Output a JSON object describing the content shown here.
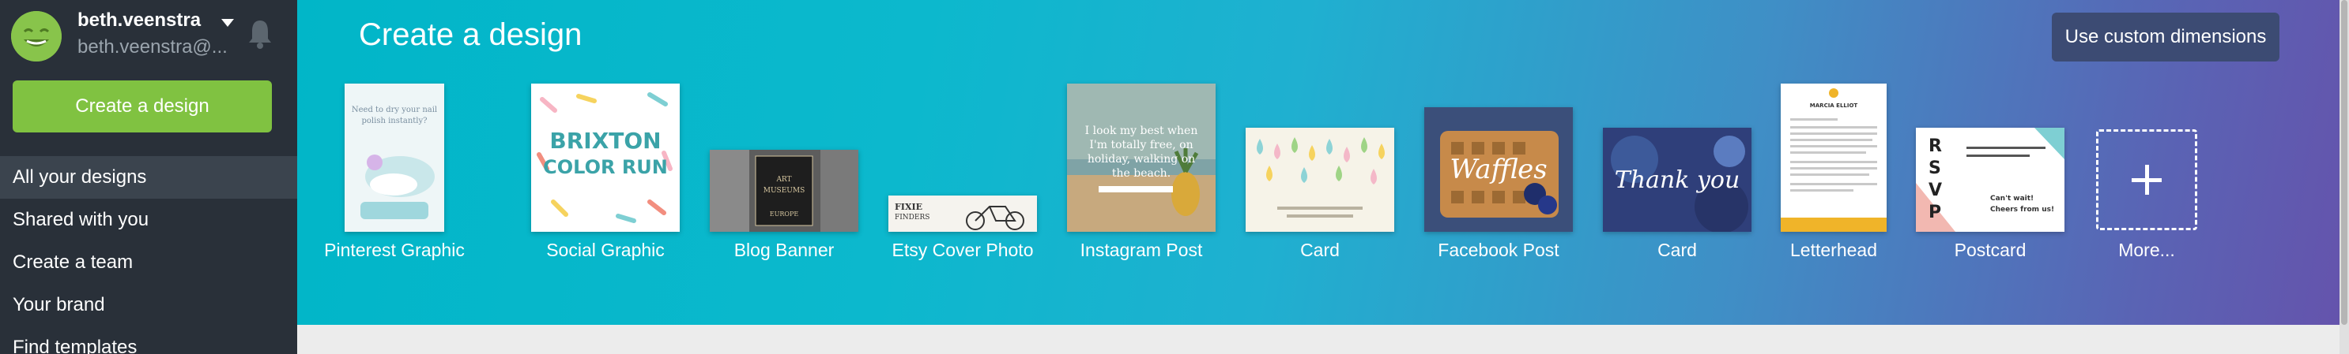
{
  "user": {
    "username": "beth.veenstra",
    "email_truncated": "beth.veenstra@..."
  },
  "sidebar": {
    "create_button": "Create a design",
    "items": [
      {
        "label": "All your designs",
        "active": true
      },
      {
        "label": "Shared with you",
        "active": false
      },
      {
        "label": "Create a team",
        "active": false
      },
      {
        "label": "Your brand",
        "active": false
      },
      {
        "label": "Find templates",
        "active": false
      }
    ]
  },
  "banner": {
    "title": "Create a design",
    "custom_dimensions_button": "Use custom dimensions",
    "tiles": [
      {
        "label": "Pinterest Graphic",
        "thumb_text": [
          "Need to dry your nail",
          "polish instantly?"
        ]
      },
      {
        "label": "Social Graphic",
        "thumb_text": [
          "BRIXTON",
          "COLOR RUN"
        ]
      },
      {
        "label": "Blog Banner",
        "thumb_text": [
          "ART",
          "MUSEUMS",
          "EUROPE"
        ]
      },
      {
        "label": "Etsy Cover Photo",
        "thumb_text": [
          "FIXIE",
          "FINDERS"
        ]
      },
      {
        "label": "Instagram Post",
        "thumb_text": [
          "I look my best when",
          "I'm totally free, on",
          "holiday, walking on",
          "the beach."
        ]
      },
      {
        "label": "Card",
        "thumb_text": []
      },
      {
        "label": "Facebook Post",
        "thumb_text": [
          "Waffles"
        ]
      },
      {
        "label": "Card",
        "thumb_text": [
          "Thank you"
        ]
      },
      {
        "label": "Letterhead",
        "thumb_text": [
          "MARCIA ELLIOT"
        ]
      },
      {
        "label": "Postcard",
        "thumb_text": [
          "R",
          "S",
          "V",
          "P",
          "Can't wait!",
          "Cheers from us!"
        ]
      },
      {
        "label": "More...",
        "thumb_text": []
      }
    ]
  },
  "colors": {
    "sidebar_bg": "#293039",
    "create_button": "#80c241",
    "custom_button": "#3c4b73",
    "banner_start": "#01b6c8",
    "banner_end": "#6553ac"
  },
  "icons": [
    "avatar-smiley",
    "chevron-down-icon",
    "bell-icon",
    "plus-icon"
  ]
}
